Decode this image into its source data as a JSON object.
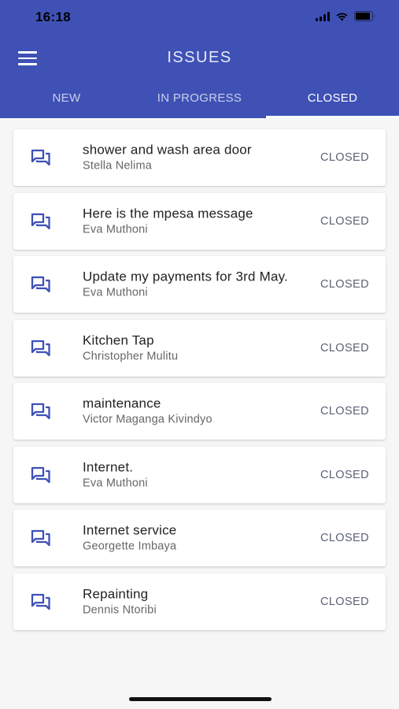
{
  "status_bar": {
    "time": "16:18"
  },
  "header": {
    "title": "ISSUES",
    "menu_icon": "hamburger-menu-icon"
  },
  "tabs": [
    {
      "label": "NEW",
      "active": false
    },
    {
      "label": "IN PROGRESS",
      "active": false
    },
    {
      "label": "CLOSED",
      "active": true
    }
  ],
  "issues": [
    {
      "subject": "shower and wash area door",
      "author": "Stella Nelima",
      "status": "CLOSED"
    },
    {
      "subject": "Here is the mpesa message",
      "author": "Eva Muthoni",
      "status": "CLOSED"
    },
    {
      "subject": "Update my payments for 3rd May.",
      "author": "Eva Muthoni",
      "status": "CLOSED"
    },
    {
      "subject": "Kitchen Tap",
      "author": "Christopher Mulitu",
      "status": "CLOSED"
    },
    {
      "subject": "maintenance",
      "author": "Victor Maganga Kivindyo",
      "status": "CLOSED"
    },
    {
      "subject": "Internet.",
      "author": "Eva Muthoni",
      "status": "CLOSED"
    },
    {
      "subject": "Internet service",
      "author": "Georgette Imbaya",
      "status": "CLOSED"
    },
    {
      "subject": "Repainting",
      "author": "Dennis Ntoribi",
      "status": "CLOSED"
    }
  ],
  "colors": {
    "primary": "#3f51b5",
    "icon": "#3f51b5",
    "background": "#f6f6f6"
  },
  "item_icon": "forum-chat-icon"
}
